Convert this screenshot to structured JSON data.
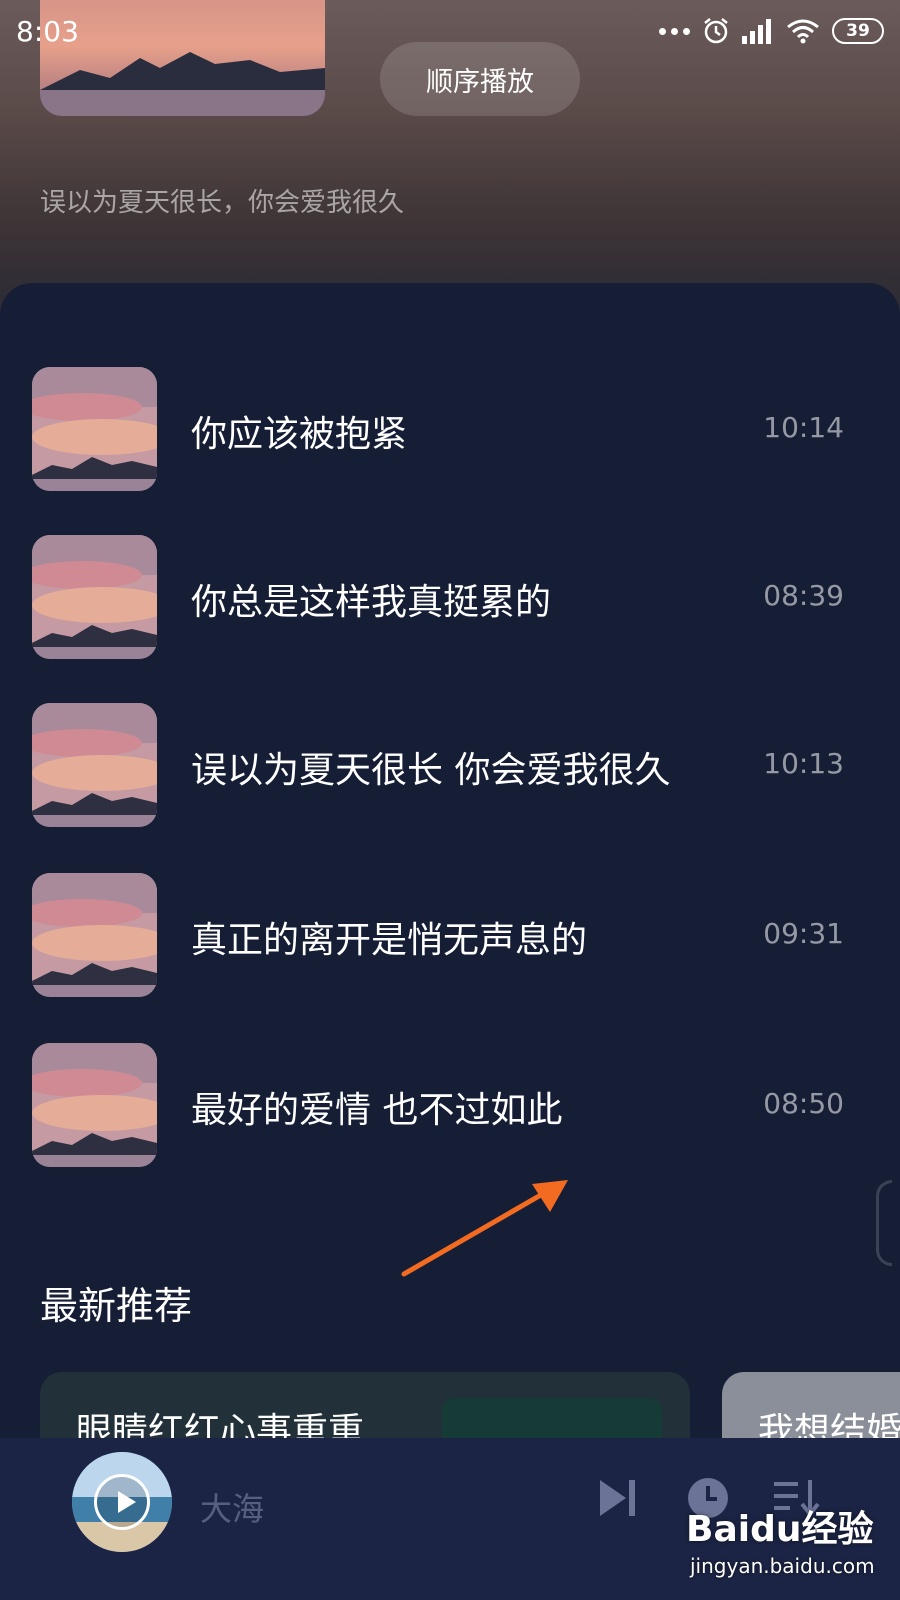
{
  "status_bar": {
    "time": "8:03",
    "battery": "39"
  },
  "header": {
    "order_button_label": "顺序播放",
    "subtitle": "误以为夏天很长，你会爱我很久"
  },
  "songs": [
    {
      "title": "你应该被抱紧",
      "duration": "10:14"
    },
    {
      "title": "你总是这样我真挺累的",
      "duration": "08:39"
    },
    {
      "title": "误以为夏天很长 你会爱我很久",
      "duration": "10:13"
    },
    {
      "title": "真正的离开是悄无声息的",
      "duration": "09:31"
    },
    {
      "title": "最好的爱情 也不过如此",
      "duration": "08:50"
    }
  ],
  "recommend": {
    "title": "最新推荐",
    "cards": [
      {
        "label": "眼睛红红心事重重"
      },
      {
        "label": "我想结婚"
      }
    ]
  },
  "player": {
    "title": "大海"
  },
  "watermark": {
    "logo": "Baidu经验",
    "url": "jingyan.baidu.com"
  },
  "colors": {
    "panel": "#161e35",
    "player_bar": "#1b2444",
    "arrow": "#f26b21"
  }
}
